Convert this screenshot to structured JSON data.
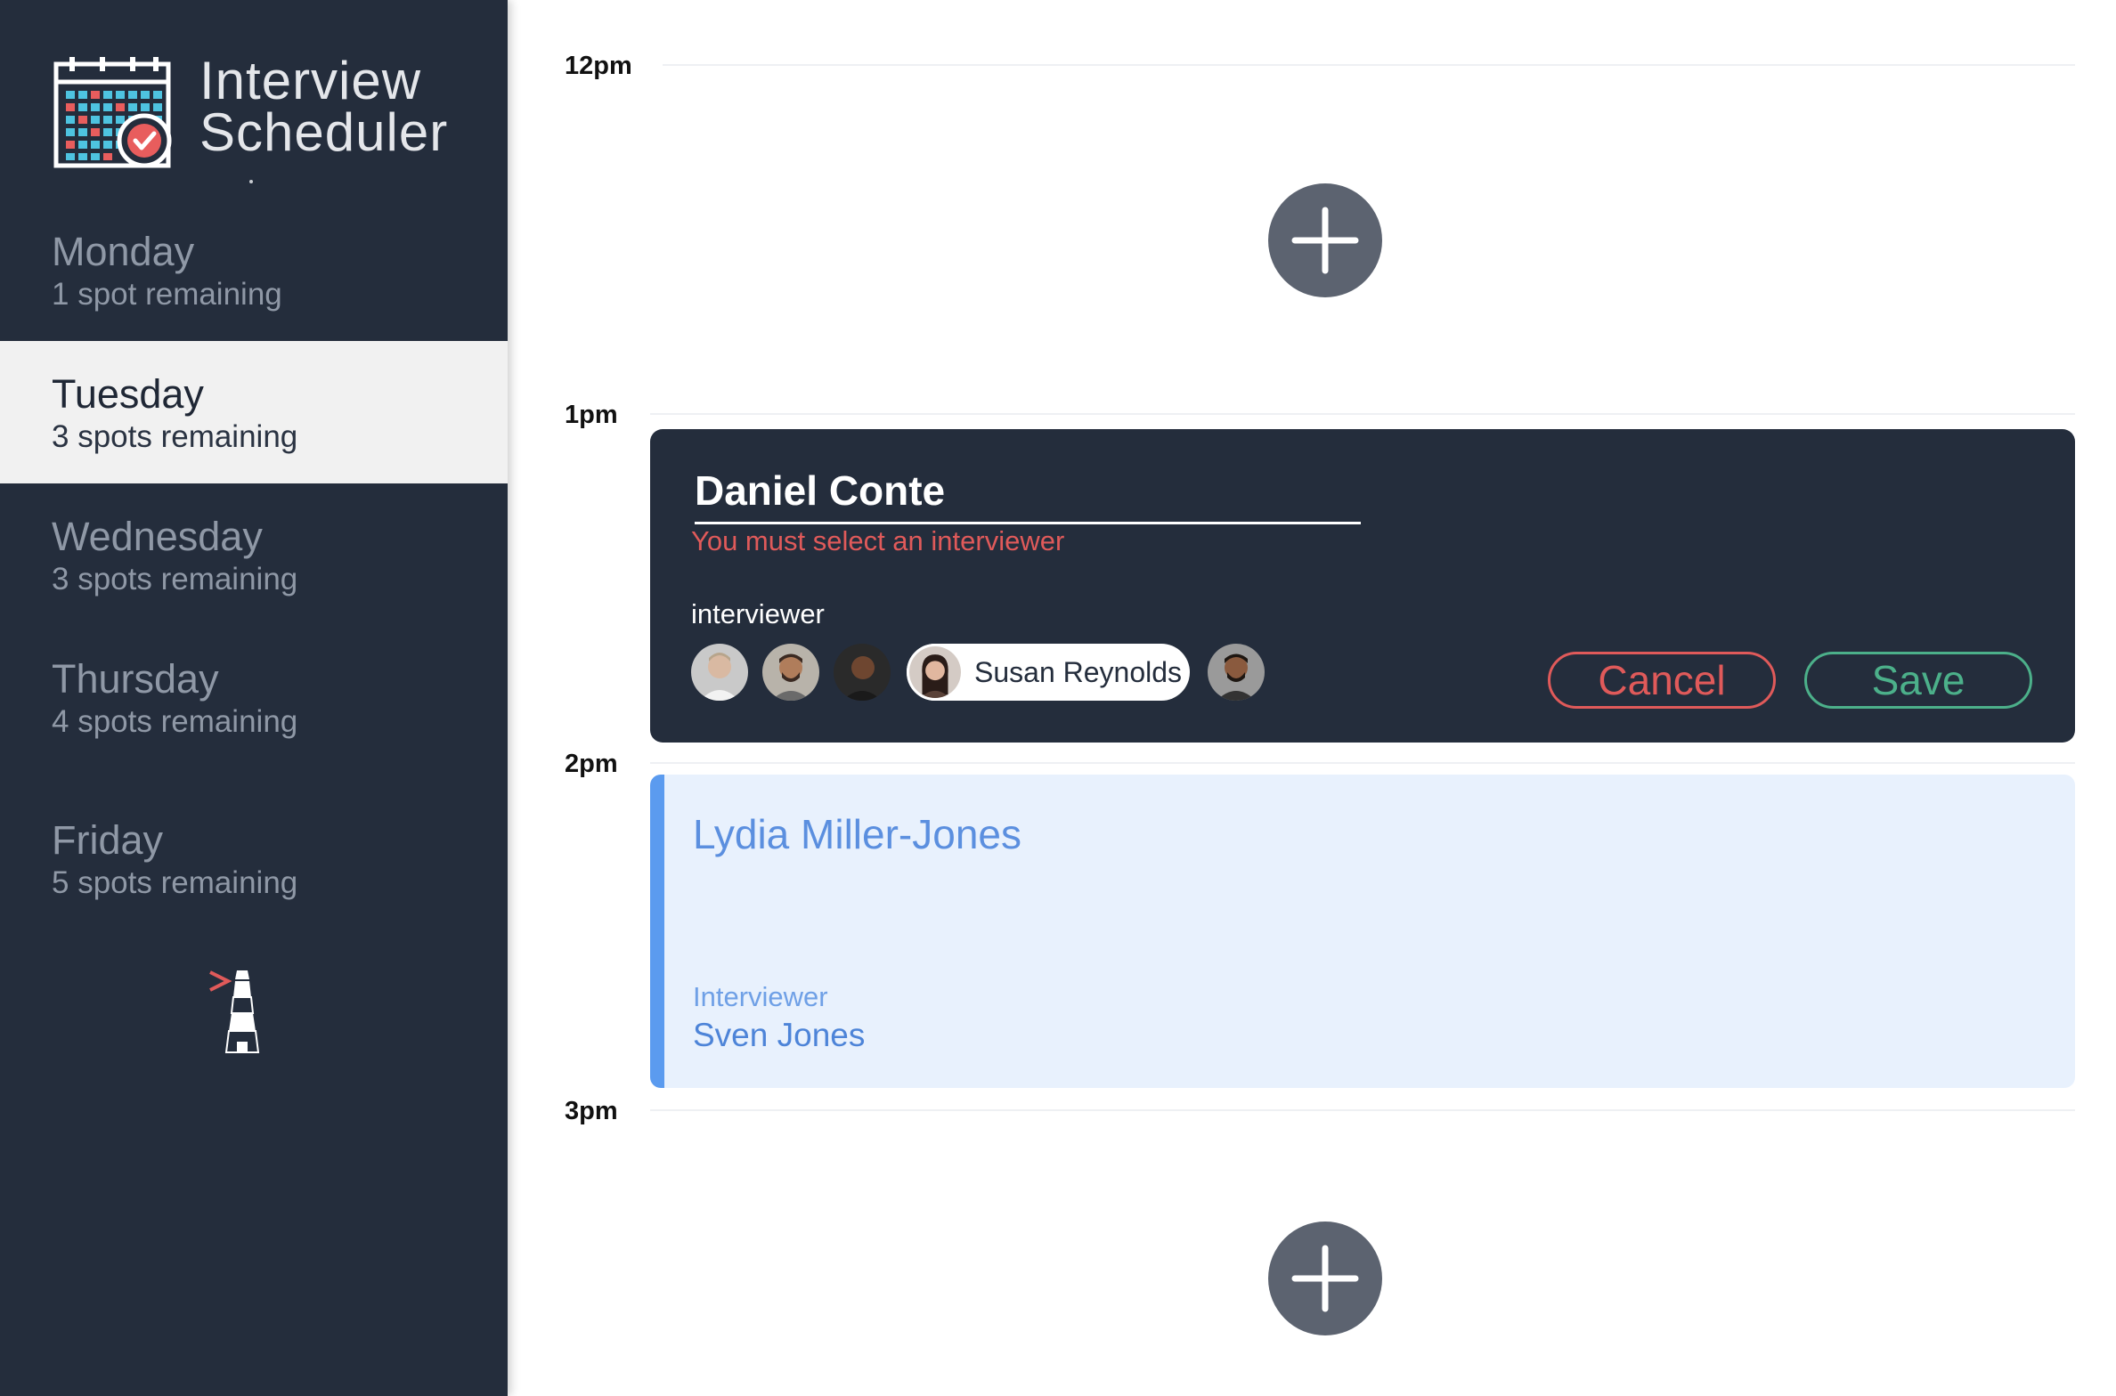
{
  "app": {
    "title_line1": "Interview",
    "title_line2": "Scheduler"
  },
  "sidebar": {
    "days": [
      {
        "name": "Monday",
        "spots": "1 spot remaining",
        "selected": false
      },
      {
        "name": "Tuesday",
        "spots": "3 spots remaining",
        "selected": true
      },
      {
        "name": "Wednesday",
        "spots": "3 spots remaining",
        "selected": false
      },
      {
        "name": "Thursday",
        "spots": "4 spots remaining",
        "selected": false
      },
      {
        "name": "Friday",
        "spots": "5 spots remaining",
        "selected": false
      }
    ],
    "footer_icon": "lighthouse-icon"
  },
  "schedule": {
    "times": [
      "12pm",
      "1pm",
      "2pm",
      "3pm"
    ],
    "add_icon": "plus-icon"
  },
  "form": {
    "student_name": "Daniel Conte",
    "error": "You must select an interviewer",
    "interviewer_label": "interviewer",
    "selected_interviewer": "Susan Reynolds",
    "cancel_label": "Cancel",
    "save_label": "Save"
  },
  "appointment": {
    "student": "Lydia Miller-Jones",
    "interviewer_label": "Interviewer",
    "interviewer": "Sven Jones"
  },
  "colors": {
    "sidebar_bg": "#242d3c",
    "error": "#e05a5a",
    "save": "#4cb08a",
    "appointment_accent": "#5b9bef",
    "appointment_bg": "#e8f1fd"
  }
}
